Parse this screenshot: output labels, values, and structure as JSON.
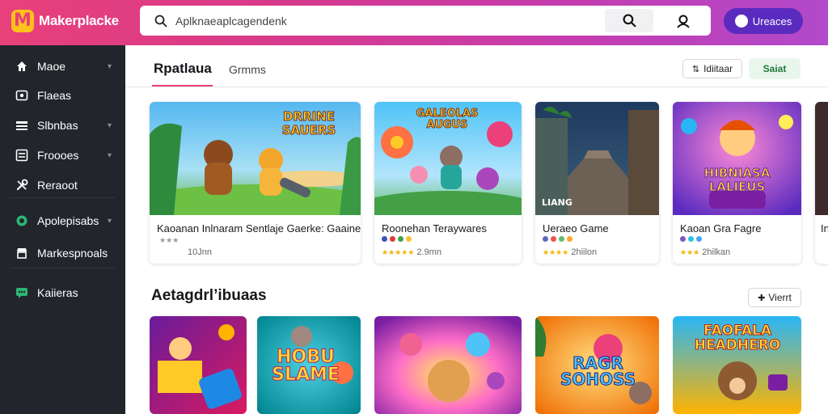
{
  "header": {
    "logo_letter": "M",
    "app_name": "Makerplacke",
    "search_placeholder": "Aplknaeaplcagendenk",
    "upgrade_label": "Ureaces"
  },
  "sidebar": {
    "items": [
      {
        "label": "Maoe",
        "icon": "home-icon",
        "has_chevron": true
      },
      {
        "label": "Flaeas",
        "icon": "image-icon",
        "has_chevron": false
      },
      {
        "label": "Slbnbas",
        "icon": "grid-icon",
        "has_chevron": true
      },
      {
        "label": "Froooes",
        "icon": "list-icon",
        "has_chevron": true
      },
      {
        "label": "Reraoot",
        "icon": "tools-icon",
        "has_chevron": false
      },
      {
        "label": "Apolepisabs",
        "icon": "green-circle-icon",
        "has_chevron": true
      },
      {
        "label": "Markespnoals",
        "icon": "store-icon",
        "has_chevron": false
      },
      {
        "label": "Kaiieras",
        "icon": "green-chat-icon",
        "has_chevron": false
      }
    ]
  },
  "tabs": {
    "active": "Rpatlaua",
    "other": "Grmms"
  },
  "toolbar": {
    "filter_label": "Idiitaar",
    "save_label": "Saiat"
  },
  "featured_cards": [
    {
      "title": "Kaoanan Inlnaram Sentlaje Gaerke: Gaaine",
      "thumb_text": "DRRINE SAUERS",
      "sub": "10Jnn"
    },
    {
      "title": "Roonehan Teraywares",
      "thumb_text": "GALEOLAS AUGUS",
      "sub": "2.9mn"
    },
    {
      "title": "Ueraeo Game",
      "thumb_text": "LIANG",
      "sub": "2hiilon"
    },
    {
      "title": "Kaoan Gra Fagre",
      "thumb_text": "HIBNIASA LALIEUS",
      "sub": "2hilkan"
    },
    {
      "title": "In",
      "thumb_text": "",
      "sub": ""
    }
  ],
  "section": {
    "title": "Aetagdrl’ibuaas",
    "view_label": "Vierrt"
  },
  "grid_thumbs": [
    {
      "text": ""
    },
    {
      "text": "HOBU SLAME"
    },
    {
      "text": ""
    },
    {
      "text": "RAGR SOHOSS"
    },
    {
      "text": "FAOFALA HEADHERO"
    }
  ],
  "colors": {
    "brand_pink": "#e8407a",
    "brand_purple": "#5b2bbf",
    "sidebar_bg": "#22252b",
    "accent_green": "#1f7a3a"
  }
}
